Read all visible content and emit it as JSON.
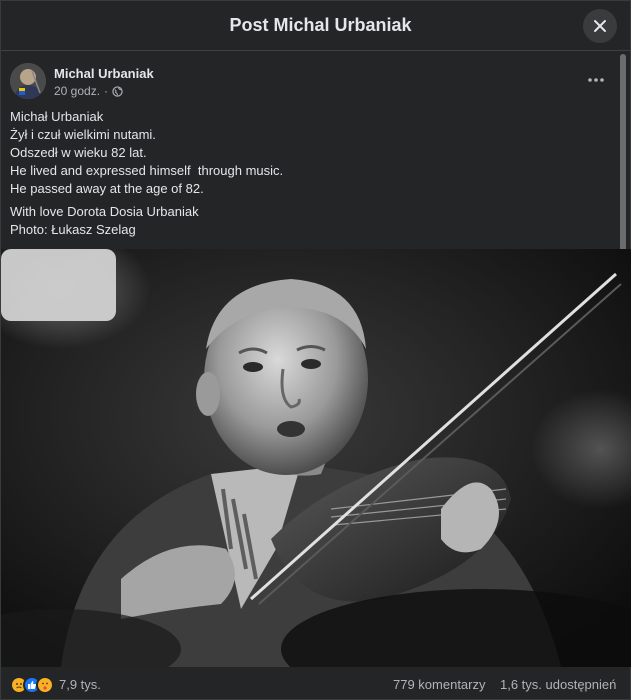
{
  "header": {
    "title": "Post Michal Urbaniak"
  },
  "post": {
    "author": "Michal Urbaniak",
    "time": "20 godz.",
    "separator": "·",
    "lines": [
      "Michał Urbaniak",
      "Żył i czuł wielkimi nutami.",
      "Odszedł w wieku 82 lat.",
      "He lived and expressed himself  through music.",
      "He passed away at the age of 82."
    ],
    "lines2": [
      "With love Dorota Dosia Urbaniak",
      "Photo: Łukasz Szelag"
    ]
  },
  "footer": {
    "reaction_count": "7,9 tys.",
    "comments": "779 komentarzy",
    "shares": "1,6 tys. udostępnień"
  },
  "icons": {
    "close": "close-icon",
    "globe": "globe-icon",
    "more": "more-horizontal-icon",
    "reactions": [
      "sad-reaction-icon",
      "like-reaction-icon",
      "care-reaction-icon"
    ]
  },
  "colors": {
    "background": "#242526",
    "text_primary": "#e4e6eb",
    "text_secondary": "#b0b3b8",
    "like_blue": "#1877f2",
    "sad_yellow": "#f7b125"
  }
}
